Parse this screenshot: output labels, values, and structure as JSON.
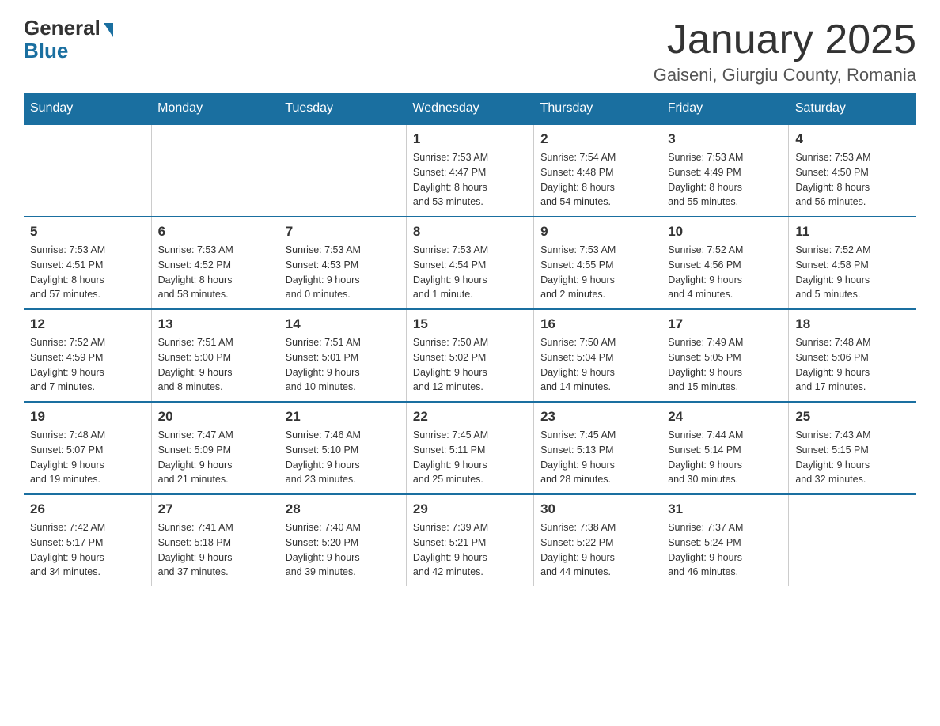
{
  "logo": {
    "general": "General",
    "blue": "Blue"
  },
  "title": "January 2025",
  "location": "Gaiseni, Giurgiu County, Romania",
  "days_of_week": [
    "Sunday",
    "Monday",
    "Tuesday",
    "Wednesday",
    "Thursday",
    "Friday",
    "Saturday"
  ],
  "weeks": [
    [
      {
        "day": "",
        "info": ""
      },
      {
        "day": "",
        "info": ""
      },
      {
        "day": "",
        "info": ""
      },
      {
        "day": "1",
        "info": "Sunrise: 7:53 AM\nSunset: 4:47 PM\nDaylight: 8 hours\nand 53 minutes."
      },
      {
        "day": "2",
        "info": "Sunrise: 7:54 AM\nSunset: 4:48 PM\nDaylight: 8 hours\nand 54 minutes."
      },
      {
        "day": "3",
        "info": "Sunrise: 7:53 AM\nSunset: 4:49 PM\nDaylight: 8 hours\nand 55 minutes."
      },
      {
        "day": "4",
        "info": "Sunrise: 7:53 AM\nSunset: 4:50 PM\nDaylight: 8 hours\nand 56 minutes."
      }
    ],
    [
      {
        "day": "5",
        "info": "Sunrise: 7:53 AM\nSunset: 4:51 PM\nDaylight: 8 hours\nand 57 minutes."
      },
      {
        "day": "6",
        "info": "Sunrise: 7:53 AM\nSunset: 4:52 PM\nDaylight: 8 hours\nand 58 minutes."
      },
      {
        "day": "7",
        "info": "Sunrise: 7:53 AM\nSunset: 4:53 PM\nDaylight: 9 hours\nand 0 minutes."
      },
      {
        "day": "8",
        "info": "Sunrise: 7:53 AM\nSunset: 4:54 PM\nDaylight: 9 hours\nand 1 minute."
      },
      {
        "day": "9",
        "info": "Sunrise: 7:53 AM\nSunset: 4:55 PM\nDaylight: 9 hours\nand 2 minutes."
      },
      {
        "day": "10",
        "info": "Sunrise: 7:52 AM\nSunset: 4:56 PM\nDaylight: 9 hours\nand 4 minutes."
      },
      {
        "day": "11",
        "info": "Sunrise: 7:52 AM\nSunset: 4:58 PM\nDaylight: 9 hours\nand 5 minutes."
      }
    ],
    [
      {
        "day": "12",
        "info": "Sunrise: 7:52 AM\nSunset: 4:59 PM\nDaylight: 9 hours\nand 7 minutes."
      },
      {
        "day": "13",
        "info": "Sunrise: 7:51 AM\nSunset: 5:00 PM\nDaylight: 9 hours\nand 8 minutes."
      },
      {
        "day": "14",
        "info": "Sunrise: 7:51 AM\nSunset: 5:01 PM\nDaylight: 9 hours\nand 10 minutes."
      },
      {
        "day": "15",
        "info": "Sunrise: 7:50 AM\nSunset: 5:02 PM\nDaylight: 9 hours\nand 12 minutes."
      },
      {
        "day": "16",
        "info": "Sunrise: 7:50 AM\nSunset: 5:04 PM\nDaylight: 9 hours\nand 14 minutes."
      },
      {
        "day": "17",
        "info": "Sunrise: 7:49 AM\nSunset: 5:05 PM\nDaylight: 9 hours\nand 15 minutes."
      },
      {
        "day": "18",
        "info": "Sunrise: 7:48 AM\nSunset: 5:06 PM\nDaylight: 9 hours\nand 17 minutes."
      }
    ],
    [
      {
        "day": "19",
        "info": "Sunrise: 7:48 AM\nSunset: 5:07 PM\nDaylight: 9 hours\nand 19 minutes."
      },
      {
        "day": "20",
        "info": "Sunrise: 7:47 AM\nSunset: 5:09 PM\nDaylight: 9 hours\nand 21 minutes."
      },
      {
        "day": "21",
        "info": "Sunrise: 7:46 AM\nSunset: 5:10 PM\nDaylight: 9 hours\nand 23 minutes."
      },
      {
        "day": "22",
        "info": "Sunrise: 7:45 AM\nSunset: 5:11 PM\nDaylight: 9 hours\nand 25 minutes."
      },
      {
        "day": "23",
        "info": "Sunrise: 7:45 AM\nSunset: 5:13 PM\nDaylight: 9 hours\nand 28 minutes."
      },
      {
        "day": "24",
        "info": "Sunrise: 7:44 AM\nSunset: 5:14 PM\nDaylight: 9 hours\nand 30 minutes."
      },
      {
        "day": "25",
        "info": "Sunrise: 7:43 AM\nSunset: 5:15 PM\nDaylight: 9 hours\nand 32 minutes."
      }
    ],
    [
      {
        "day": "26",
        "info": "Sunrise: 7:42 AM\nSunset: 5:17 PM\nDaylight: 9 hours\nand 34 minutes."
      },
      {
        "day": "27",
        "info": "Sunrise: 7:41 AM\nSunset: 5:18 PM\nDaylight: 9 hours\nand 37 minutes."
      },
      {
        "day": "28",
        "info": "Sunrise: 7:40 AM\nSunset: 5:20 PM\nDaylight: 9 hours\nand 39 minutes."
      },
      {
        "day": "29",
        "info": "Sunrise: 7:39 AM\nSunset: 5:21 PM\nDaylight: 9 hours\nand 42 minutes."
      },
      {
        "day": "30",
        "info": "Sunrise: 7:38 AM\nSunset: 5:22 PM\nDaylight: 9 hours\nand 44 minutes."
      },
      {
        "day": "31",
        "info": "Sunrise: 7:37 AM\nSunset: 5:24 PM\nDaylight: 9 hours\nand 46 minutes."
      },
      {
        "day": "",
        "info": ""
      }
    ]
  ]
}
